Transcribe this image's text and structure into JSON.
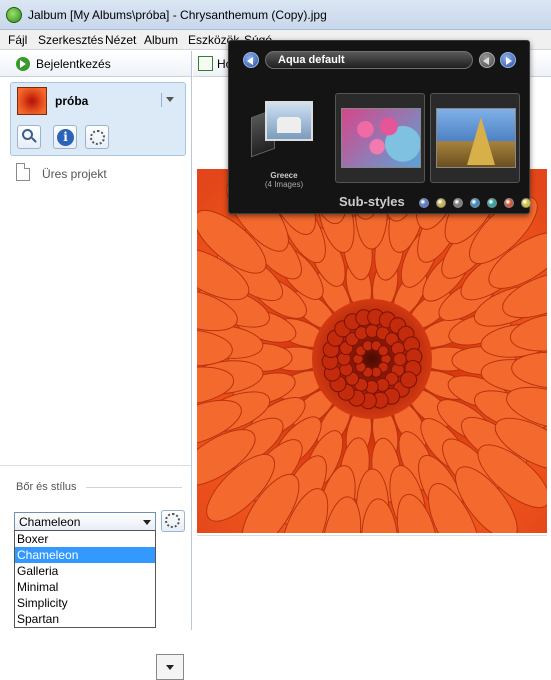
{
  "window": {
    "title": "Jalbum [My Albums\\próba] - Chrysanthemum (Copy).jpg"
  },
  "menu": [
    {
      "label": "Fájl"
    },
    {
      "label": "Szerkesztés"
    },
    {
      "label": "Nézet"
    },
    {
      "label": "Album"
    },
    {
      "label": "Eszközök"
    },
    {
      "label": "Súgó"
    }
  ],
  "left": {
    "login_label": "Bejelentkezés",
    "project": {
      "name": "próba"
    },
    "empty_project_label": "Üres projekt",
    "skin": {
      "section_label": "Bőr és stílus",
      "selected": "Chameleon",
      "options": [
        "Boxer",
        "Chameleon",
        "Galleria",
        "Minimal",
        "Simplicity",
        "Spartan"
      ]
    }
  },
  "right": {
    "home_label": "Ho"
  },
  "style_picker": {
    "style_name": "Aqua default",
    "folder": {
      "name": "Greece",
      "count": "(4 Images)"
    },
    "sub_styles_label": "Sub-styles",
    "sub_style_colors": [
      "#5a7bd3",
      "#c9b34a",
      "#7d7d7d",
      "#3a8dc9",
      "#2fa5a3",
      "#d4583a",
      "#d6c43a"
    ]
  },
  "colors": {
    "selection": "#3399ff",
    "project_bg": "#dceaf8",
    "overlay_bg": "#141414"
  }
}
